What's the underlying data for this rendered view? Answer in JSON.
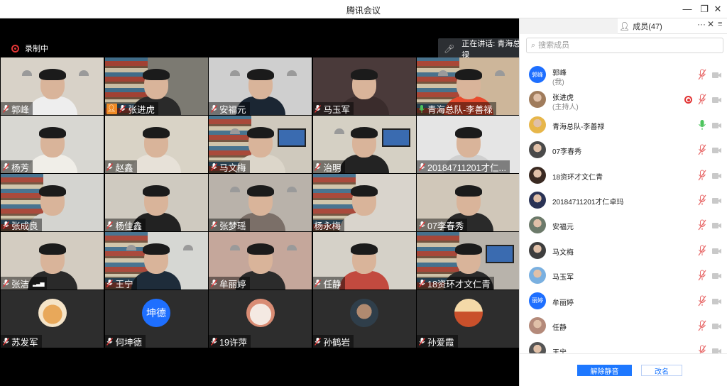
{
  "window": {
    "title": "腾讯会议",
    "minimize_icon": "minimize-icon",
    "restore_icon": "restore-icon",
    "close_icon": "close-icon"
  },
  "stage": {
    "recording_label": "录制中",
    "speaking_label": "正在讲话: 青海总队-李善禄"
  },
  "tiles": [
    {
      "name": "郭峰",
      "scene": "#d8d2c8",
      "body": "#eeeeee",
      "host": false,
      "mic": "muted"
    },
    {
      "name": "张进虎",
      "scene": "#7c7a72",
      "body": "#2a2a2a",
      "host": true,
      "mic": "muted"
    },
    {
      "name": "安福元",
      "scene": "#cfcfcf",
      "body": "#1b2633",
      "host": false,
      "mic": "muted"
    },
    {
      "name": "马玉军",
      "scene": "#4a3a3a",
      "body": "#3a2c2c",
      "host": false,
      "mic": "muted"
    },
    {
      "name": "青海总队-李善禄",
      "scene": "#cdb69a",
      "body": "#e84b2d",
      "host": false,
      "mic": "on"
    },
    {
      "name": "杨芳",
      "scene": "#d8d7d2",
      "body": "#f0eee8",
      "host": false,
      "mic": "muted"
    },
    {
      "name": "赵鑫",
      "scene": "#d9d3c6",
      "body": "#e7e1d8",
      "host": false,
      "mic": "muted"
    },
    {
      "name": "马文梅",
      "scene": "#cfc9bd",
      "body": "#dcd6ca",
      "host": false,
      "mic": "muted"
    },
    {
      "name": "治明",
      "scene": "#d5d0c4",
      "body": "#232323",
      "host": false,
      "mic": "muted"
    },
    {
      "name": "20184711201才仁...",
      "scene": "#e5e5e5",
      "body": "#cfcfcf",
      "host": false,
      "mic": "muted"
    },
    {
      "name": "张成良",
      "scene": "#d4d4d0",
      "body": "#d4d4d0",
      "host": false,
      "mic": "muted"
    },
    {
      "name": "杨佳鑫",
      "scene": "#cfcac0",
      "body": "#222222",
      "host": false,
      "mic": "muted"
    },
    {
      "name": "张梦瑶",
      "scene": "#b9b2aa",
      "body": "#7b6f68",
      "host": false,
      "mic": "muted"
    },
    {
      "name": "杨永梅",
      "scene": "#d9d4cc",
      "body": "#d9d4cc",
      "host": false,
      "mic": "none"
    },
    {
      "name": "07李春秀",
      "scene": "#d0c7b9",
      "body": "#2a2a2a",
      "host": false,
      "mic": "muted"
    },
    {
      "name": "张洁",
      "scene": "#d3ccc1",
      "body": "#2a2a2a",
      "host": false,
      "mic": "muted",
      "signal": true
    },
    {
      "name": "王宁",
      "scene": "#d6d7d3",
      "body": "#1e2c3a",
      "host": false,
      "mic": "muted"
    },
    {
      "name": "牟丽婷",
      "scene": "#c5a79b",
      "body": "#2b2b2b",
      "host": false,
      "mic": "muted"
    },
    {
      "name": "任静",
      "scene": "#d5d1c8",
      "body": "#c24a3f",
      "host": false,
      "mic": "muted"
    },
    {
      "name": "18资环才文仁青",
      "scene": "#b8b3ab",
      "body": "#2b2b2b",
      "host": false,
      "mic": "muted"
    },
    {
      "name": "苏发军",
      "scene": "#2d2d2d",
      "avatar": "dog",
      "host": false,
      "mic": "muted"
    },
    {
      "name": "何坤德",
      "scene": "#2d2d2d",
      "avatar_text": "坤德",
      "host": false,
      "mic": "muted"
    },
    {
      "name": "19许萍",
      "scene": "#2d2d2d",
      "avatar": "cat",
      "host": false,
      "mic": "muted"
    },
    {
      "name": "孙鹤岩",
      "scene": "#2d2d2d",
      "avatar": "man",
      "host": false,
      "mic": "muted"
    },
    {
      "name": "孙爱霞",
      "scene": "#2d2d2d",
      "avatar": "sky",
      "host": false,
      "mic": "muted"
    }
  ],
  "panel": {
    "tab_members": "成员(47)",
    "more_icon": "more-icon",
    "close_icon": "close-icon",
    "menu_icon": "menu-icon",
    "search_placeholder": "搜索成员",
    "members": [
      {
        "name": "郭峰",
        "role": "(我)",
        "avatar_text": "郭峰",
        "mic": "muted"
      },
      {
        "name": "张进虎",
        "role": "(主持人)",
        "avatar": "#a07c5c",
        "mic": "muted",
        "recording": true
      },
      {
        "name": "青海总队-李善禄",
        "role": "",
        "avatar": "#e7b64a",
        "mic": "on"
      },
      {
        "name": "07李春秀",
        "role": "",
        "avatar": "#4a4a4a",
        "mic": "muted"
      },
      {
        "name": "18资环才文仁青",
        "role": "",
        "avatar": "#3a2a22",
        "mic": "muted"
      },
      {
        "name": "20184711201才仁卓玛",
        "role": "",
        "avatar": "#2a3355",
        "mic": "muted"
      },
      {
        "name": "安福元",
        "role": "",
        "avatar": "#6c7a6a",
        "mic": "muted"
      },
      {
        "name": "马文梅",
        "role": "",
        "avatar": "#3e3e3e",
        "mic": "muted"
      },
      {
        "name": "马玉军",
        "role": "",
        "avatar": "#7ab0e0",
        "mic": "muted"
      },
      {
        "name": "牟丽婷",
        "role": "",
        "avatar_text": "丽婷",
        "mic": "muted"
      },
      {
        "name": "任静",
        "role": "",
        "avatar": "#b48a7a",
        "mic": "muted"
      },
      {
        "name": "王宁",
        "role": "",
        "avatar": "#555555",
        "mic": "muted"
      }
    ],
    "unmute_button": "解除静音",
    "rename_button": "改名"
  },
  "colors": {
    "accent": "#1e78ff",
    "mic_on": "#4cc45c",
    "mic_muted": "#e23636",
    "stage_bg": "#000000"
  }
}
